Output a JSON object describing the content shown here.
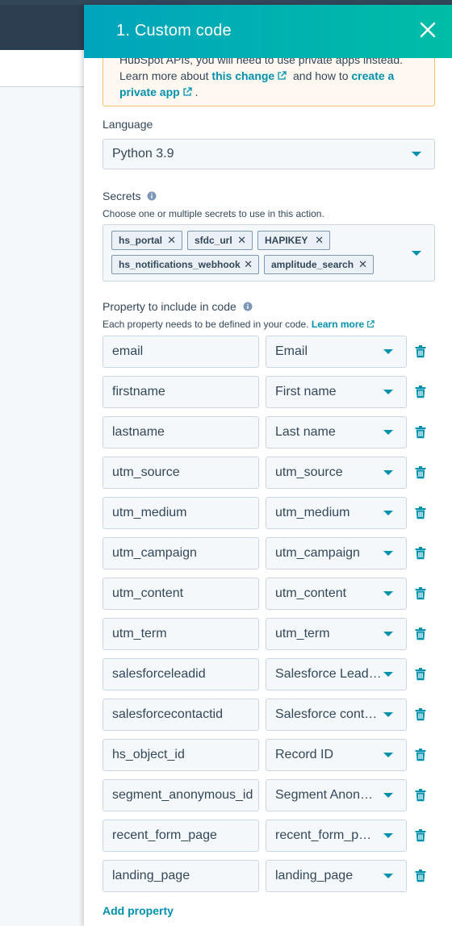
{
  "panel": {
    "title": "1. Custom code",
    "accent_color": "#00a4bd"
  },
  "warning": {
    "line1": "HubSpot APIs, you will need to use private apps instead.",
    "line2_prefix": "Learn more about",
    "line2_link1": "this change",
    "line2_middle": "and how to",
    "line2_link2": "create a",
    "line3_link2": "private app",
    "line3_suffix": "."
  },
  "language": {
    "label": "Language",
    "value": "Python 3.9"
  },
  "secrets": {
    "label": "Secrets",
    "help": "Choose one or multiple secrets to use in this action.",
    "tags": [
      "hs_portal",
      "sfdc_url",
      "HAPIKEY",
      "hs_notifications_webhook",
      "amplitude_search"
    ]
  },
  "properties": {
    "label": "Property to include in code",
    "help": "Each property needs to be defined in your code.",
    "help_link": "Learn more",
    "rows": [
      {
        "name": "email",
        "property": "Email"
      },
      {
        "name": "firstname",
        "property": "First name"
      },
      {
        "name": "lastname",
        "property": "Last name"
      },
      {
        "name": "utm_source",
        "property": "utm_source"
      },
      {
        "name": "utm_medium",
        "property": "utm_medium"
      },
      {
        "name": "utm_campaign",
        "property": "utm_campaign"
      },
      {
        "name": "utm_content",
        "property": "utm_content"
      },
      {
        "name": "utm_term",
        "property": "utm_term"
      },
      {
        "name": "salesforceleadid",
        "property": "Salesforce Lead…"
      },
      {
        "name": "salesforcecontactid",
        "property": "Salesforce cont…"
      },
      {
        "name": "hs_object_id",
        "property": "Record ID"
      },
      {
        "name": "segment_anonymous_id",
        "property": "Segment Anon…"
      },
      {
        "name": "recent_form_page",
        "property": "recent_form_p…"
      },
      {
        "name": "landing_page",
        "property": "landing_page"
      }
    ],
    "add_label": "Add property"
  }
}
